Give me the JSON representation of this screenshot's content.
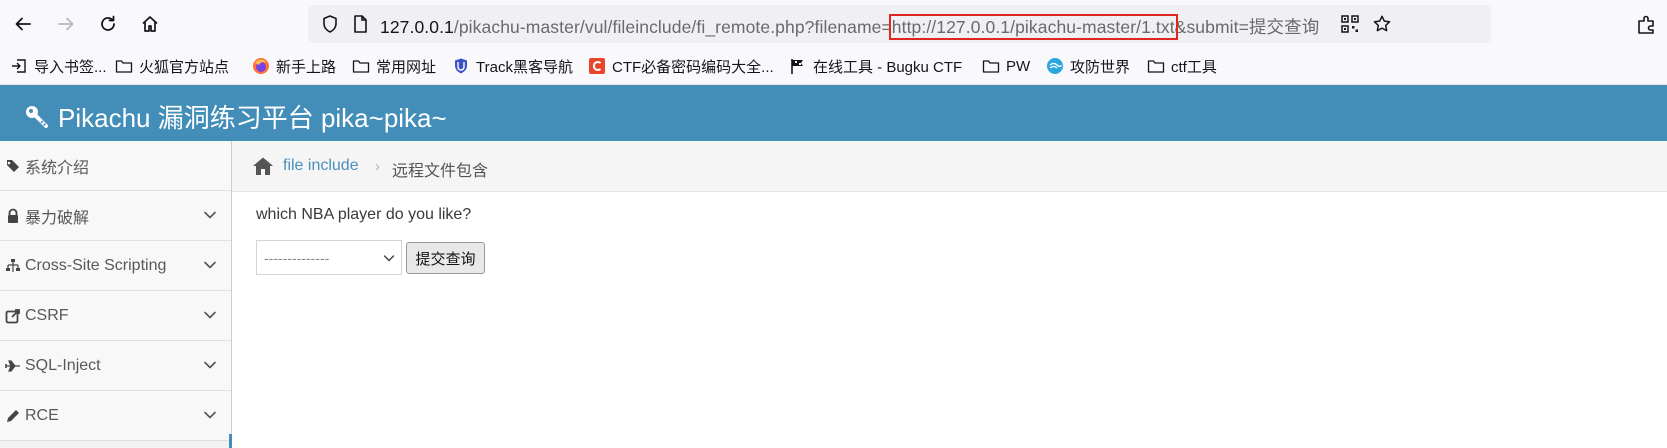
{
  "browser": {
    "url": {
      "host": "127.0.0.1",
      "path": "/pikachu-master/vul/fileinclude/fi_remote.php?filename=",
      "highlighted": "http://127.0.0.1/pikachu-master/1.txt",
      "rest": "&submit=提交查询"
    },
    "highlight_color": "#e0271f"
  },
  "bookmarks": [
    {
      "label": "导入书签...",
      "icon": "import-icon"
    },
    {
      "label": "火狐官方站点",
      "icon": "folder-icon"
    },
    {
      "label": "新手上路",
      "icon": "firefox-icon"
    },
    {
      "label": "常用网址",
      "icon": "folder-icon"
    },
    {
      "label": "Track黑客导航",
      "icon": "shield-icon"
    },
    {
      "label": "CTF必备密码编码大全...",
      "icon": "c-logo-icon"
    },
    {
      "label": "在线工具 - Bugku CTF",
      "icon": "flag-icon"
    },
    {
      "label": "PW",
      "icon": "folder-icon"
    },
    {
      "label": "攻防世界",
      "icon": "globe-icon"
    },
    {
      "label": "ctf工具",
      "icon": "folder-icon"
    }
  ],
  "header": {
    "title": "Pikachu 漏洞练习平台 pika~pika~",
    "color": "#438eb9"
  },
  "sidebar": {
    "items": [
      {
        "label": "系统介绍",
        "icon": "tags-icon",
        "expandable": false
      },
      {
        "label": "暴力破解",
        "icon": "lock-icon",
        "expandable": true
      },
      {
        "label": "Cross-Site Scripting",
        "icon": "sitemap-icon",
        "expandable": true
      },
      {
        "label": "CSRF",
        "icon": "share-icon",
        "expandable": true
      },
      {
        "label": "SQL-Inject",
        "icon": "plane-icon",
        "expandable": true
      },
      {
        "label": "RCE",
        "icon": "pencil-icon",
        "expandable": true
      }
    ]
  },
  "breadcrumb": {
    "link": "file include",
    "separator": "›",
    "current": "远程文件包含"
  },
  "main": {
    "question": "which NBA player do you like?",
    "select_value": "--------------",
    "submit_label": "提交查询"
  }
}
